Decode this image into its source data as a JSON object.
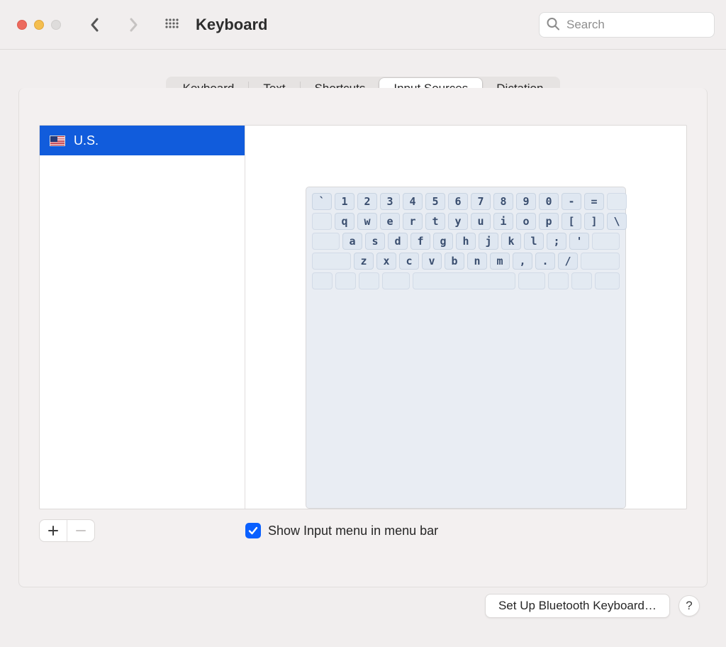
{
  "toolbar": {
    "title": "Keyboard",
    "search_placeholder": "Search"
  },
  "tabs": {
    "keyboard": "Keyboard",
    "text": "Text",
    "shortcuts": "Shortcuts",
    "input_sources": "Input Sources",
    "dictation": "Dictation",
    "selected": "input_sources"
  },
  "sidebar": {
    "items": [
      {
        "flag": "us",
        "label": "U.S."
      }
    ]
  },
  "keyboard_preview": {
    "row1": [
      "`",
      "1",
      "2",
      "3",
      "4",
      "5",
      "6",
      "7",
      "8",
      "9",
      "0",
      "-",
      "="
    ],
    "row2": [
      "q",
      "w",
      "e",
      "r",
      "t",
      "y",
      "u",
      "i",
      "o",
      "p",
      "[",
      "]",
      "\\"
    ],
    "row3": [
      "a",
      "s",
      "d",
      "f",
      "g",
      "h",
      "j",
      "k",
      "l",
      ";",
      "'"
    ],
    "row4": [
      "z",
      "x",
      "c",
      "v",
      "b",
      "n",
      "m",
      ",",
      ".",
      "/"
    ]
  },
  "controls": {
    "show_input_menu_label": "Show Input menu in menu bar",
    "show_input_menu_checked": true
  },
  "footer": {
    "bluetooth_button": "Set Up Bluetooth Keyboard…",
    "help": "?"
  },
  "colors": {
    "selection": "#115cdc",
    "accent": "#0a60ff"
  }
}
